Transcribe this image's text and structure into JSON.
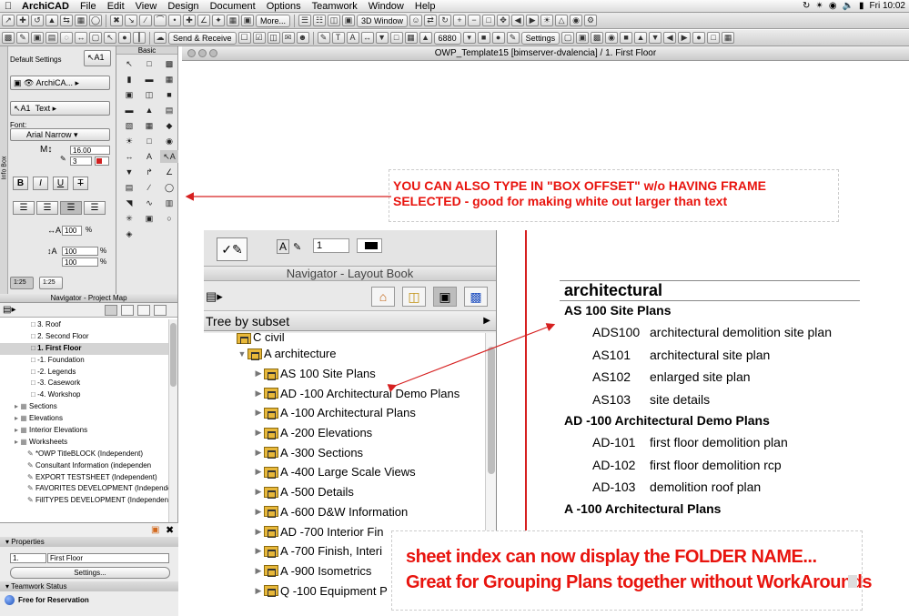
{
  "menubar": {
    "app": "ArchiCAD",
    "items": [
      "File",
      "Edit",
      "View",
      "Design",
      "Document",
      "Options",
      "Teamwork",
      "Window",
      "Help"
    ],
    "clock": "Fri 10:02"
  },
  "toolbar": {
    "more_label": "More...",
    "window_3d_label": "3D Window",
    "send_receive_label": "Send & Receive",
    "settings_label": "Settings",
    "zoom_value": "6880"
  },
  "window": {
    "title": "OWP_Template15  [bimserver-dvalencia] / 1. First Floor"
  },
  "infobox": {
    "side_label": "Info Box",
    "default_settings": "Default Settings",
    "layer_value": "ArchiCA...",
    "text_value": "Text",
    "font_label": "Font:",
    "font_value": "Arial Narrow",
    "size_value": "16.00",
    "pen_value": "3",
    "width_value": "100",
    "spacing_a": "100",
    "spacing_b": "100",
    "scale_a": "1:25",
    "scale_b": "1:25"
  },
  "toolbox": {
    "header": "Basic"
  },
  "navigator": {
    "header": "Navigator - Project Map",
    "tree": [
      {
        "label": "3. Roof",
        "indent": 3,
        "selected": false
      },
      {
        "label": "2. Second Floor",
        "indent": 3,
        "selected": false
      },
      {
        "label": "1. First Floor",
        "indent": 3,
        "selected": true
      },
      {
        "label": "-1. Foundation",
        "indent": 3,
        "selected": false
      },
      {
        "label": "-2. Legends",
        "indent": 3,
        "selected": false
      },
      {
        "label": "-3. Casework",
        "indent": 3,
        "selected": false
      },
      {
        "label": "-4. Workshop",
        "indent": 3,
        "selected": false
      },
      {
        "label": "Sections",
        "indent": 1,
        "selected": false
      },
      {
        "label": "Elevations",
        "indent": 1,
        "selected": false
      },
      {
        "label": "Interior Elevations",
        "indent": 1,
        "selected": false
      },
      {
        "label": "Worksheets",
        "indent": 1,
        "selected": false
      },
      {
        "label": "*OWP TitleBLOCK (Independent)",
        "indent": 2,
        "selected": false
      },
      {
        "label": "Consultant Information (independen",
        "indent": 2,
        "selected": false
      },
      {
        "label": "EXPORT TESTSHEET (Independent)",
        "indent": 2,
        "selected": false
      },
      {
        "label": "FAVORITES DEVELOPMENT (Independe",
        "indent": 2,
        "selected": false
      },
      {
        "label": "FillTYPES DEVELOPMENT (Independen",
        "indent": 2,
        "selected": false
      }
    ]
  },
  "properties": {
    "header": "Properties",
    "id": "1.",
    "name": "First Floor",
    "settings_button": "Settings...",
    "teamwork_header": "Teamwork Status",
    "status": "Free for Reservation"
  },
  "layoutbook": {
    "header": "Navigator - Layout Book",
    "pen_value": "1",
    "dropdown": "Tree by subset",
    "items": [
      {
        "label": "C civil",
        "level": 1,
        "cut": true
      },
      {
        "label": "A architecture",
        "level": 1,
        "open": true
      },
      {
        "label": "AS 100 Site Plans",
        "level": 2
      },
      {
        "label": "AD -100 Architectural Demo Plans",
        "level": 2
      },
      {
        "label": "A -100 Architectural Plans",
        "level": 2
      },
      {
        "label": "A -200 Elevations",
        "level": 2
      },
      {
        "label": "A -300 Sections",
        "level": 2
      },
      {
        "label": "A -400 Large Scale Views",
        "level": 2
      },
      {
        "label": "A -500 Details",
        "level": 2
      },
      {
        "label": "A -600 D&W Information",
        "level": 2
      },
      {
        "label": "AD -700 Interior Fin",
        "level": 2
      },
      {
        "label": "A -700 Finish, Interi",
        "level": 2
      },
      {
        "label": "A -900 Isometrics",
        "level": 2
      },
      {
        "label": "Q -100 Equipment P",
        "level": 2
      }
    ]
  },
  "sheet_index": {
    "title": "architectural",
    "groups": [
      {
        "name": "AS 100 Site Plans",
        "rows": [
          {
            "num": "ADS100",
            "desc": "architectural demolition site plan"
          },
          {
            "num": "AS101",
            "desc": "architectural site plan"
          },
          {
            "num": "AS102",
            "desc": "enlarged site plan"
          },
          {
            "num": "AS103",
            "desc": "site details"
          }
        ]
      },
      {
        "name": "AD -100 Architectural Demo Plans",
        "rows": [
          {
            "num": "AD-101",
            "desc": "first floor demolition plan"
          },
          {
            "num": "AD-102",
            "desc": "first floor demolition rcp"
          },
          {
            "num": "AD-103",
            "desc": "demolition roof plan"
          }
        ]
      },
      {
        "name": "A -100 Architectural Plans",
        "rows": []
      }
    ]
  },
  "annotations": {
    "note1_line1": "YOU CAN ALSO TYPE IN \"BOX OFFSET\" w/o HAVING  FRAME",
    "note1_line2": "SELECTED - good for making white out larger than text",
    "note2_line1": "sheet index can now display the FOLDER NAME...",
    "note2_line2": "Great for Grouping Plans together without WorkArounds",
    "color": "#e8140e"
  }
}
